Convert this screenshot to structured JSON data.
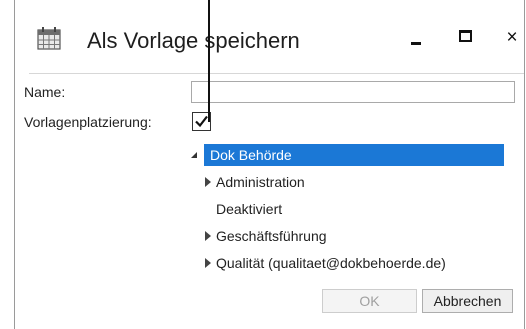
{
  "window": {
    "title": "Als Vorlage speichern",
    "icons": {
      "app": "calendar-grid-icon",
      "minimize": "minimize-icon",
      "maximize": "maximize-icon",
      "close": "close-icon"
    },
    "close_glyph": "×"
  },
  "form": {
    "name_label": "Name:",
    "name_value": "",
    "placement_label": "Vorlagenplatzierung:",
    "placement_checked": true,
    "check_glyph": "✔"
  },
  "tree": {
    "root": {
      "label": "Dok Behörde",
      "expanded": true,
      "selected": true
    },
    "children": [
      {
        "label": "Administration",
        "has_children": true
      },
      {
        "label": "Deaktiviert",
        "has_children": false
      },
      {
        "label": "Geschäftsführung",
        "has_children": true
      },
      {
        "label": "Qualität (qualitaet@dokbehoerde.de)",
        "has_children": true
      }
    ]
  },
  "buttons": {
    "ok": "OK",
    "cancel": "Abbrechen"
  },
  "colors": {
    "selection": "#1b78d6",
    "disabled_text": "#a0a0a0"
  }
}
